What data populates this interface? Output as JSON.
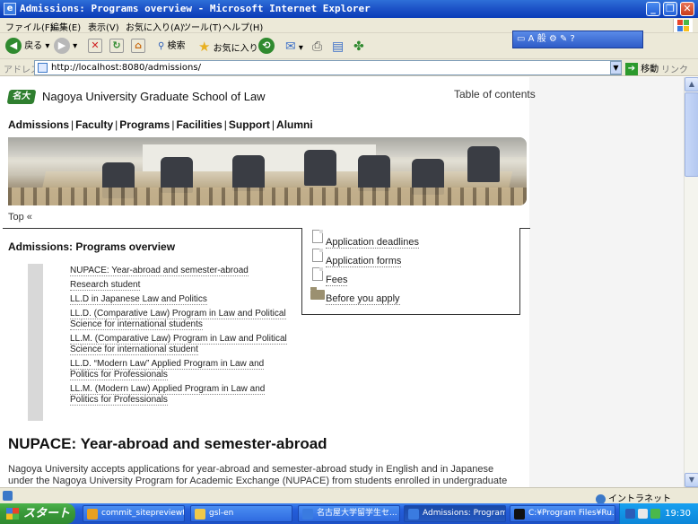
{
  "window": {
    "title": "Admissions: Programs overview - Microsoft Internet Explorer",
    "app_icon": "ie-icon",
    "buttons": [
      "minimize",
      "maximize",
      "close"
    ]
  },
  "menu": [
    "ファイル(F)",
    "編集(E)",
    "表示(V)",
    "お気に入り(A)",
    "ツール(T)",
    "ヘルプ(H)"
  ],
  "toolbar": {
    "back_label": "戻る",
    "search_label": "検索",
    "favorites_label": "お気に入り",
    "ime_text": "A 般"
  },
  "address": {
    "label": "アドレス(D)",
    "url": "http://localhost:8080/admissions/",
    "go_label": "移動",
    "links_label": "リンク"
  },
  "page": {
    "site_title": "Nagoya University Graduate School of Law",
    "toc_link": "Table of contents",
    "nav": [
      "Admissions",
      "Faculty",
      "Programs",
      "Facilities",
      "Support",
      "Alumni"
    ],
    "breadcrumb": "Top «",
    "heading": "Admissions: Programs overview",
    "sidebox_items": [
      {
        "label": "Application deadlines",
        "icon": "document-icon"
      },
      {
        "label": "Application forms",
        "icon": "document-icon"
      },
      {
        "label": "Fees",
        "icon": "document-icon"
      },
      {
        "label": "Before you apply",
        "icon": "folder-icon"
      }
    ],
    "subnav": [
      "NUPACE: Year-abroad and semester-abroad",
      "Research student",
      "LL.D in Japanese Law and Politics",
      "LL.D. (Comparative Law) Program in Law and Political Science for international students",
      "LL.M. (Comparative Law) Program in Law and Political Science for international student",
      "LL.D. “Modern Law” Applied Program in Law and Politics for Professionals",
      "LL.M. (Modern Law) Applied Program in Law and Politics for Professionals"
    ],
    "section_title": "NUPACE: Year-abroad and semester-abroad",
    "section_text": "Nagoya University accepts applications for year-abroad and semester-abroad study in English and in Japanese under the Nagoya University Program for Academic Exchange (NUPACE) from students enrolled in undergraduate"
  },
  "status": {
    "zone": "イントラネット"
  },
  "taskbar": {
    "start_label": "スタート",
    "tasks": [
      {
        "label": "commit_sitepreviewt...",
        "active": false
      },
      {
        "label": "gsl-en",
        "active": false
      },
      {
        "label": "名古屋大学留学生セ...",
        "active": false
      },
      {
        "label": "Admissions: Program...",
        "active": true
      },
      {
        "label": "C:¥Program Files¥Ru...",
        "active": false
      }
    ],
    "clock": "19:30"
  },
  "colors": {
    "titlebar": "#1e54c8",
    "chrome": "#ece9d8",
    "taskbar": "#245edb",
    "start": "#3a9a3a",
    "logo_green": "#2f7f2f"
  }
}
